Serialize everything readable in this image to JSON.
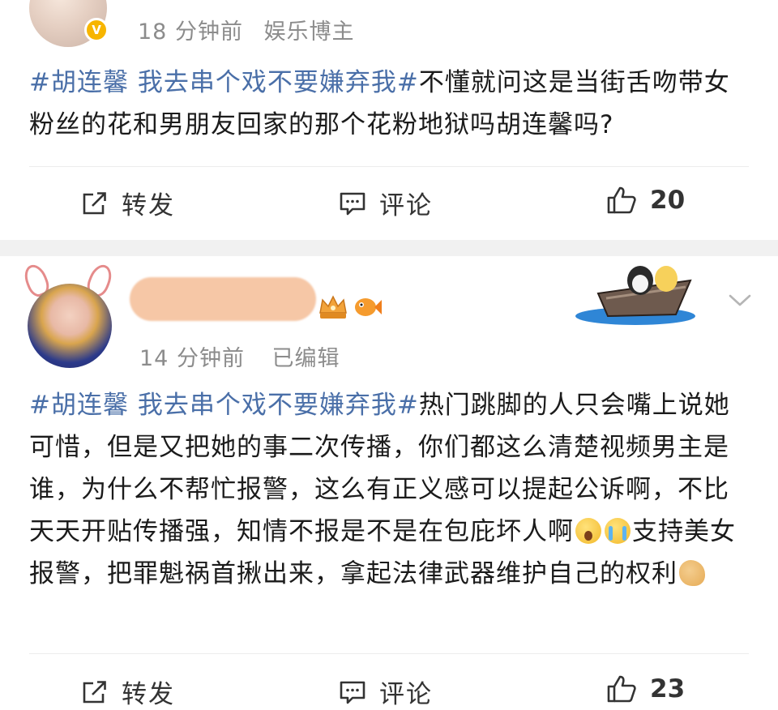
{
  "post1": {
    "meta_time": "18 分钟前",
    "meta_source": "娱乐博主",
    "verified_mark": "V",
    "content": {
      "hashtag": "#胡连馨 我去串个戏不要嫌弃我#",
      "text": "不懂就问这是当街舌吻带女粉丝的花和男朋友回家的那个花粉地狱吗胡连馨吗?"
    },
    "actions": {
      "repost_label": "转发",
      "comment_label": "评论",
      "like_count": "20"
    }
  },
  "post2": {
    "meta_time": "14 分钟前",
    "meta_edited": "已编辑",
    "content": {
      "hashtag": "#胡连馨 我去串个戏不要嫌弃我#",
      "text_a": "热门跳脚的人只会嘴上说她可惜，但是又把她的事二次传播，你们都这么清楚视频男主是谁，为什么不帮忙报警，这么有正义感可以提起公诉啊，不比天天开贴传播强，知情不报是不是在包庇坏人啊",
      "text_b": "支持美女报警，把罪魁祸首揪出来，拿起法律武器维护自己的权利"
    },
    "actions": {
      "repost_label": "转发",
      "comment_label": "评论",
      "like_count": "23"
    }
  },
  "icons": {
    "verified": "verified-v-icon",
    "repost": "repost-icon",
    "comment": "comment-icon",
    "like": "thumbs-up-icon",
    "more": "chevron-down-icon",
    "crown": "crown-badge-icon",
    "fish": "fish-badge-icon",
    "boat": "boat-sticker-icon",
    "emoji_wow": "astonished-emoji-icon",
    "emoji_cry": "crying-emoji-icon",
    "emoji_muscle": "flexed-biceps-emoji-icon"
  },
  "colors": {
    "hashtag": "#4a6fa8",
    "meta_text": "#8c8c8c",
    "verified_badge": "#f7b500",
    "separator": "#f1f1f1"
  }
}
